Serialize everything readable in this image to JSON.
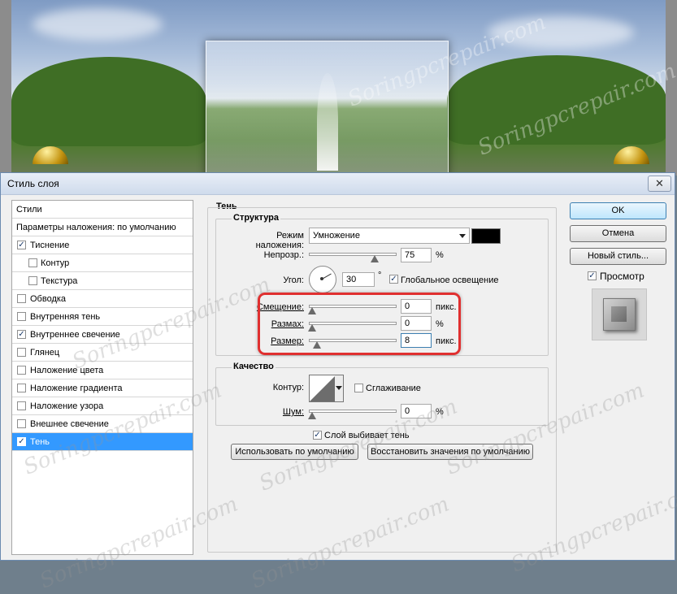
{
  "dialog": {
    "title": "Стиль слоя",
    "close_glyph": "✕"
  },
  "styles_panel": {
    "header": "Стили",
    "blending_options": "Параметры наложения: по умолчанию",
    "items": [
      {
        "label": "Тиснение",
        "checked": true,
        "indent": false
      },
      {
        "label": "Контур",
        "checked": false,
        "indent": true
      },
      {
        "label": "Текстура",
        "checked": false,
        "indent": true
      },
      {
        "label": "Обводка",
        "checked": false,
        "indent": false
      },
      {
        "label": "Внутренняя тень",
        "checked": false,
        "indent": false
      },
      {
        "label": "Внутреннее свечение",
        "checked": true,
        "indent": false
      },
      {
        "label": "Глянец",
        "checked": false,
        "indent": false
      },
      {
        "label": "Наложение цвета",
        "checked": false,
        "indent": false
      },
      {
        "label": "Наложение градиента",
        "checked": false,
        "indent": false
      },
      {
        "label": "Наложение узора",
        "checked": false,
        "indent": false
      },
      {
        "label": "Внешнее свечение",
        "checked": false,
        "indent": false
      },
      {
        "label": "Тень",
        "checked": true,
        "indent": false,
        "selected": true
      }
    ],
    "check_glyph": "✓"
  },
  "shadow": {
    "section_title": "Тень",
    "structure_title": "Структура",
    "blend_mode_label": "Режим наложения:",
    "blend_mode_value": "Умножение",
    "shadow_color": "#000000",
    "opacity_label": "Непрозр.:",
    "opacity_value": "75",
    "opacity_unit": "%",
    "opacity_fraction": 0.75,
    "angle_label": "Угол:",
    "angle_value": "30",
    "angle_unit": "°",
    "global_light_label": "Глобальное освещение",
    "global_light_checked": true,
    "distance_label": "Смещение:",
    "distance_value": "0",
    "distance_unit": "пикс.",
    "spread_label": "Размах:",
    "spread_value": "0",
    "spread_unit": "%",
    "size_label": "Размер:",
    "size_value": "8",
    "size_unit": "пикс."
  },
  "quality": {
    "title": "Качество",
    "contour_label": "Контур:",
    "antialias_label": "Сглаживание",
    "antialias_checked": false,
    "noise_label": "Шум:",
    "noise_value": "0",
    "noise_unit": "%"
  },
  "layer_knocks_out_label": "Слой выбивает тень",
  "layer_knocks_out_checked": true,
  "buttons": {
    "make_default": "Использовать по умолчанию",
    "reset_default": "Восстановить значения по умолчанию",
    "ok": "OK",
    "cancel": "Отмена",
    "new_style": "Новый стиль...",
    "preview": "Просмотр",
    "preview_checked": true
  },
  "watermark_text": "Soringpcrepair.com"
}
